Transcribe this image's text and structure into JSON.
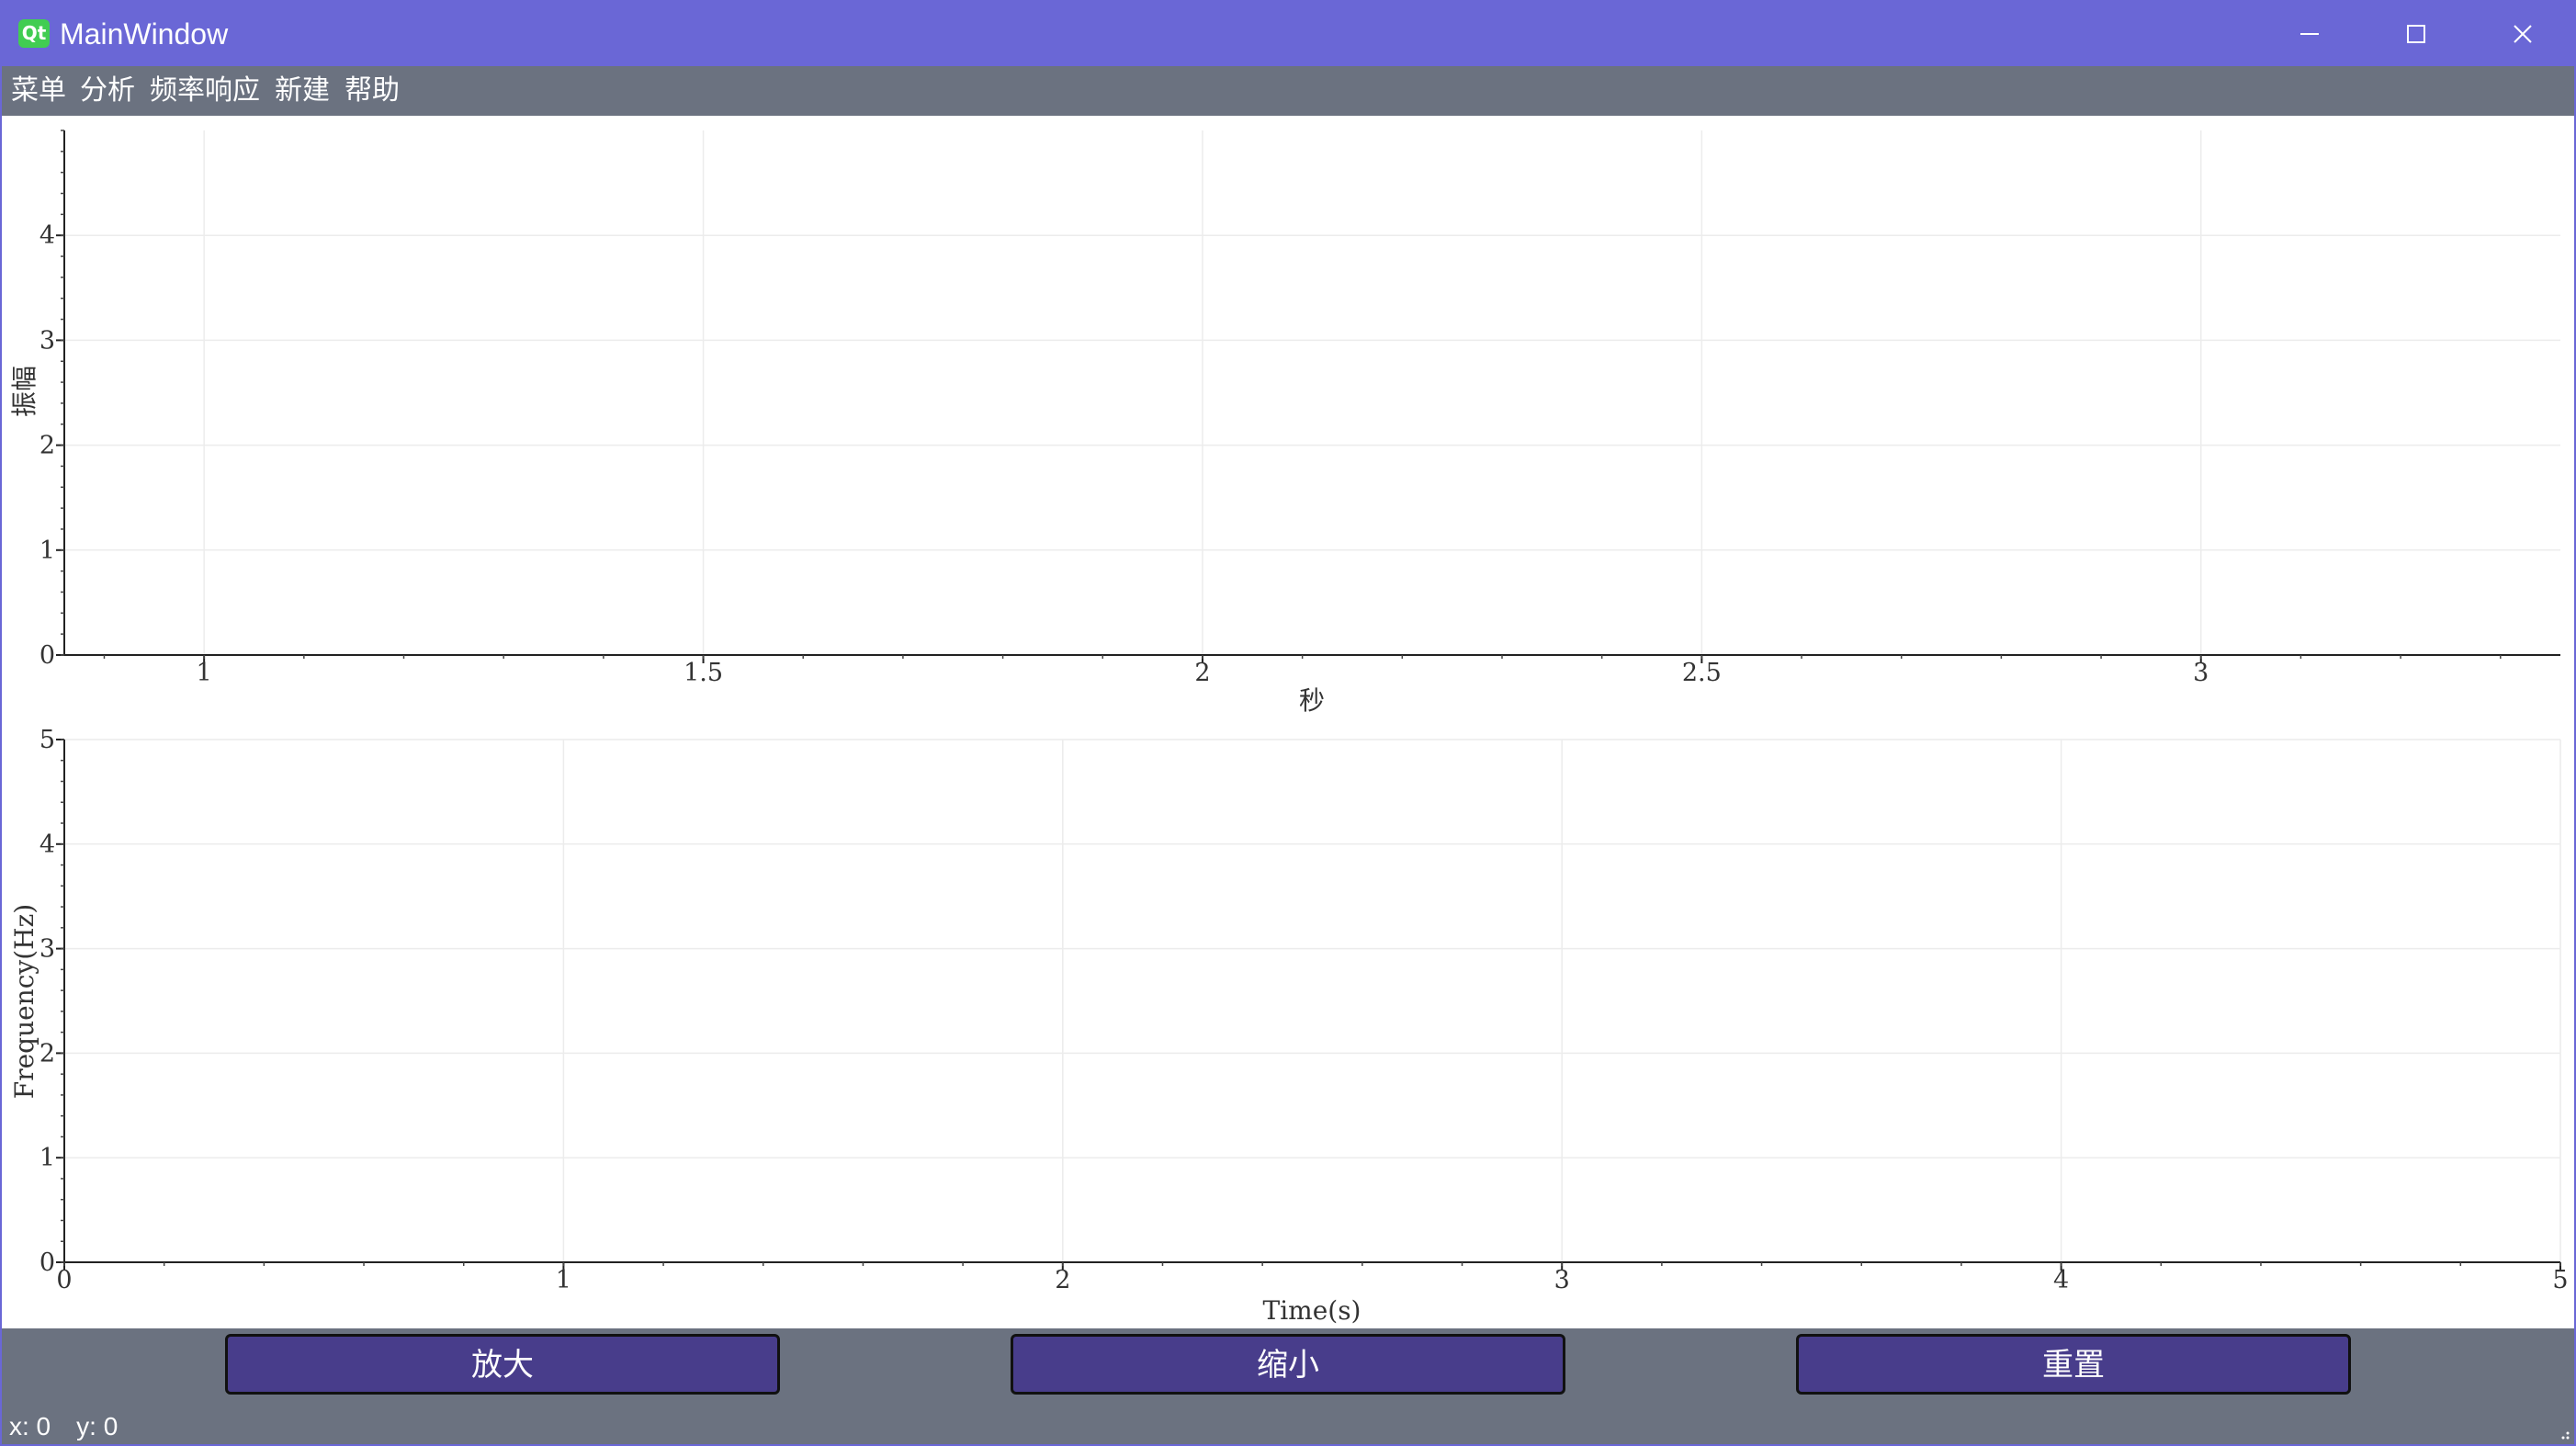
{
  "window": {
    "title": "MainWindow",
    "logo_text": "Qt",
    "buttons": {
      "minimize": "—",
      "maximize": "☐",
      "close": "✕"
    }
  },
  "menu": {
    "items": [
      "菜单",
      "分析",
      "频率响应",
      "新建",
      "帮助"
    ]
  },
  "plots": {
    "top": {
      "xlabel": "秒",
      "ylabel": "振幅",
      "x_ticks": [
        1,
        1.5,
        2,
        2.5,
        3
      ],
      "x_tick_labels": [
        "1",
        "1.5",
        "2",
        "2.5",
        "3"
      ],
      "y_ticks": [
        0,
        1,
        2,
        3,
        4
      ],
      "y_tick_labels": [
        "0",
        "1",
        "2",
        "3",
        "4"
      ],
      "xlim": [
        0.86,
        3.36
      ],
      "ylim": [
        0,
        5
      ],
      "grid": true
    },
    "bottom": {
      "xlabel": "Time(s)",
      "ylabel": "Frequency(Hz)",
      "x_ticks": [
        0,
        1,
        2,
        3,
        4,
        5
      ],
      "x_tick_labels": [
        "0",
        "1",
        "2",
        "3",
        "4",
        "5"
      ],
      "y_ticks": [
        0,
        1,
        2,
        3,
        4,
        5
      ],
      "y_tick_labels": [
        "0",
        "1",
        "2",
        "3",
        "4",
        "5"
      ],
      "xlim": [
        0,
        5
      ],
      "ylim": [
        0,
        5
      ],
      "grid": true
    }
  },
  "chart_data": [
    {
      "type": "line",
      "series": [],
      "xlabel": "秒",
      "ylabel": "振幅",
      "xlim": [
        0.86,
        3.36
      ],
      "ylim": [
        0,
        5
      ],
      "grid": true
    },
    {
      "type": "line",
      "series": [],
      "xlabel": "Time(s)",
      "ylabel": "Frequency(Hz)",
      "xlim": [
        0,
        5
      ],
      "ylim": [
        0,
        5
      ],
      "grid": true
    }
  ],
  "buttons": {
    "zoom_in": "放大",
    "zoom_out": "缩小",
    "reset": "重置"
  },
  "status": {
    "x": "x: 0",
    "y": "y: 0"
  },
  "colors": {
    "titlebar": "#6a67d6",
    "background": "#6b7280",
    "button": "#483d8b",
    "plot_bg": "#ffffff"
  }
}
